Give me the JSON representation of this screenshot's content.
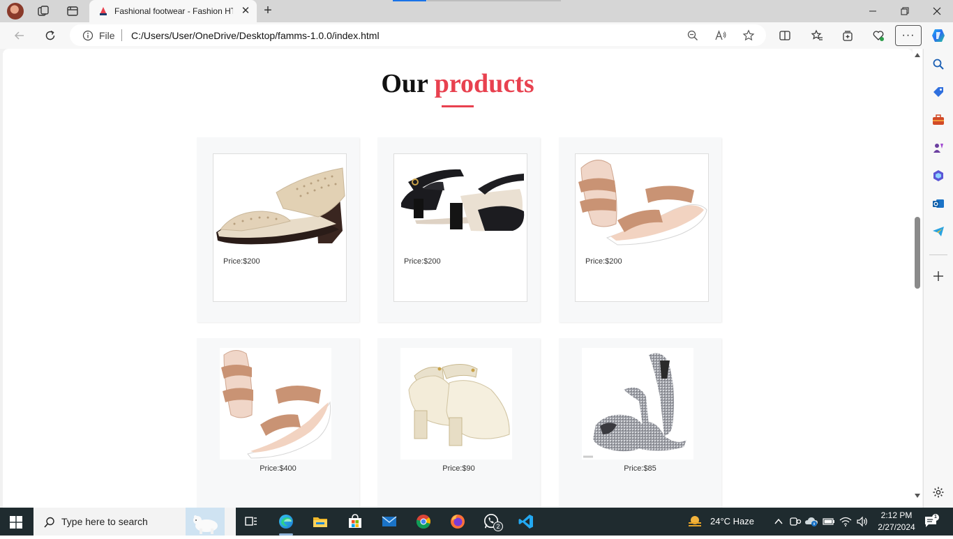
{
  "browser": {
    "tab_title": "Fashional footwear - Fashion HTML",
    "address_scheme": "File",
    "url": "C:/Users/User/OneDrive/Desktop/famms-1.0.0/index.html"
  },
  "page": {
    "heading_part1": "Our",
    "heading_part2": "products",
    "accent_color": "#e8414f",
    "products": [
      {
        "price": "Price:$200",
        "image": "beige-perforated-wedge-sandal"
      },
      {
        "price": "Price:$200",
        "image": "black-block-heel-sandal"
      },
      {
        "price": "Price:$200",
        "image": "pink-strappy-platform-sandal"
      },
      {
        "price": "Price:$400",
        "image": "pink-strappy-platform-sandal"
      },
      {
        "price": "Price:$90",
        "image": "cream-pointed-block-heel-pump"
      },
      {
        "price": "Price:$85",
        "image": "silver-glitter-peep-toe-heels"
      }
    ]
  },
  "taskbar": {
    "search_placeholder": "Type here to search",
    "weather": "24°C  Haze",
    "time": "2:12 PM",
    "date": "2/27/2024",
    "whatsapp_badge": "2"
  }
}
